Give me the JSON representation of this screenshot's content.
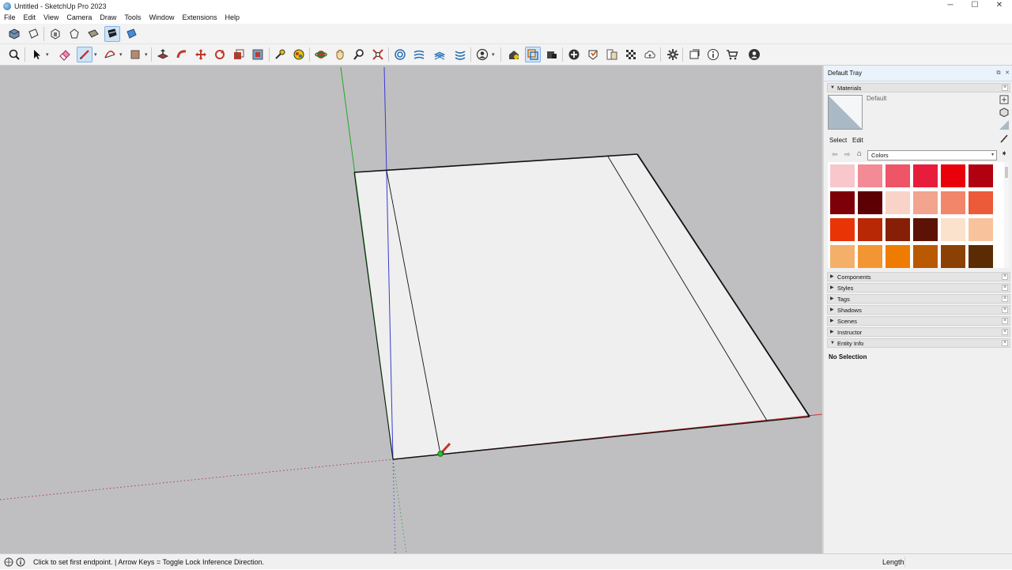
{
  "window": {
    "title": "Untitled - SketchUp Pro 2023",
    "minimize": "─",
    "maximize": "☐",
    "close": "✕"
  },
  "menu": [
    "File",
    "Edit",
    "View",
    "Camera",
    "Draw",
    "Tools",
    "Window",
    "Extensions",
    "Help"
  ],
  "tray": {
    "title": "Default Tray",
    "materials": {
      "header": "Materials",
      "current_name": "Default",
      "tab_select": "Select",
      "tab_edit": "Edit",
      "library": "Colors",
      "swatches": [
        "#f7c7cc",
        "#f28b95",
        "#ee5566",
        "#e81d3c",
        "#e8000b",
        "#b10010",
        "#7d0008",
        "#5c0004",
        "#f9d3c8",
        "#f2a48f",
        "#f1866a",
        "#ec5a39",
        "#e93406",
        "#b92805",
        "#861f06",
        "#5c1305",
        "#fbe2cc",
        "#f8c39c",
        "#f4af6b",
        "#f29633",
        "#ee7c00",
        "#b95a03",
        "#8a4104",
        "#5b2c04"
      ]
    },
    "panels": [
      "Components",
      "Styles",
      "Tags",
      "Shadows",
      "Scenes",
      "Instructor",
      "Entity Info"
    ],
    "entity_info_text": "No Selection"
  },
  "status": {
    "message": "Click to set first endpoint. | Arrow Keys = Toggle Lock Inference Direction.",
    "measure_label": "Length",
    "measure_value": ""
  }
}
